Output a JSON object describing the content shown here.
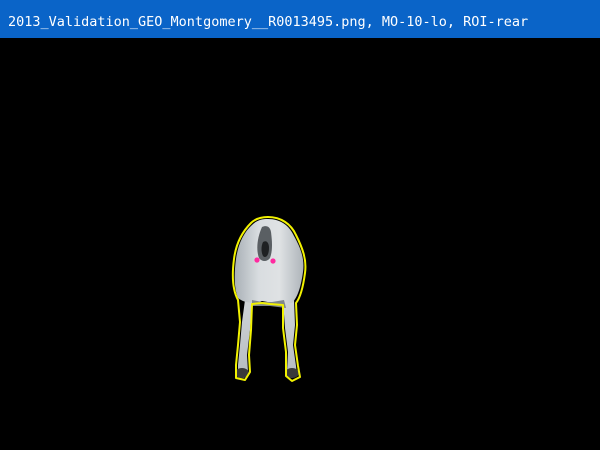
{
  "window": {
    "title": "2013_Validation_GEO_Montgomery__R0013495.png, MO-10-lo, ROI-rear"
  },
  "viewer": {
    "subject": "goat-rear-view",
    "roi_outline_color": "#f2f200",
    "marker_color": "#ff2aa0",
    "background_color": "#000000"
  },
  "colors": {
    "titlebar": "#0a64c8",
    "title_text": "#ffffff"
  }
}
